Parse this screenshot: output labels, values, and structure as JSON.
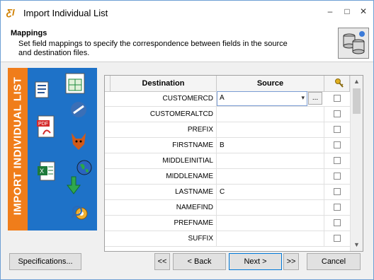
{
  "window": {
    "title": "Import Individual List",
    "icon_text": "ƸI",
    "controls": {
      "minimize": "–",
      "maximize": "□",
      "close": "✕"
    }
  },
  "header": {
    "title": "Mappings",
    "description": "Set field mappings to specify the correspondence between fields in the source and destination files."
  },
  "sidebar": {
    "label": "IMPORT INDIVIDUAL LIST",
    "icons": [
      "word-document-icon",
      "spreadsheet-icon",
      "pdf-icon",
      "browser-icon",
      "fox-icon",
      "excel-icon",
      "globe-icon",
      "green-arrow-icon",
      "search-gear-icon"
    ]
  },
  "grid": {
    "columns": {
      "destination": "Destination",
      "source": "Source",
      "key": "key-icon"
    },
    "rows": [
      {
        "destination": "CUSTOMERCD",
        "source": "A",
        "checked": false,
        "editing": true
      },
      {
        "destination": "CUSTOMERALTCD",
        "source": "",
        "checked": false
      },
      {
        "destination": "PREFIX",
        "source": "",
        "checked": false
      },
      {
        "destination": "FIRSTNAME",
        "source": "B",
        "checked": false
      },
      {
        "destination": "MIDDLEINITIAL",
        "source": "",
        "checked": false
      },
      {
        "destination": "MIDDLENAME",
        "source": "",
        "checked": false
      },
      {
        "destination": "LASTNAME",
        "source": "C",
        "checked": false
      },
      {
        "destination": "NAMEFIND",
        "source": "",
        "checked": false
      },
      {
        "destination": "PREFNAME",
        "source": "",
        "checked": false
      },
      {
        "destination": "SUFFIX",
        "source": "",
        "checked": false
      }
    ],
    "ellipsis_label": "...",
    "scroll": {
      "up": "▲",
      "down": "▼"
    }
  },
  "buttons": {
    "specifications": "Specifications...",
    "first": "<<",
    "back": "< Back",
    "next": "Next >",
    "last": ">>",
    "cancel": "Cancel"
  },
  "colors": {
    "sidebar_blue": "#1e72c8",
    "sidebar_orange": "#f07d1a",
    "focus_blue": "#0078d7"
  }
}
